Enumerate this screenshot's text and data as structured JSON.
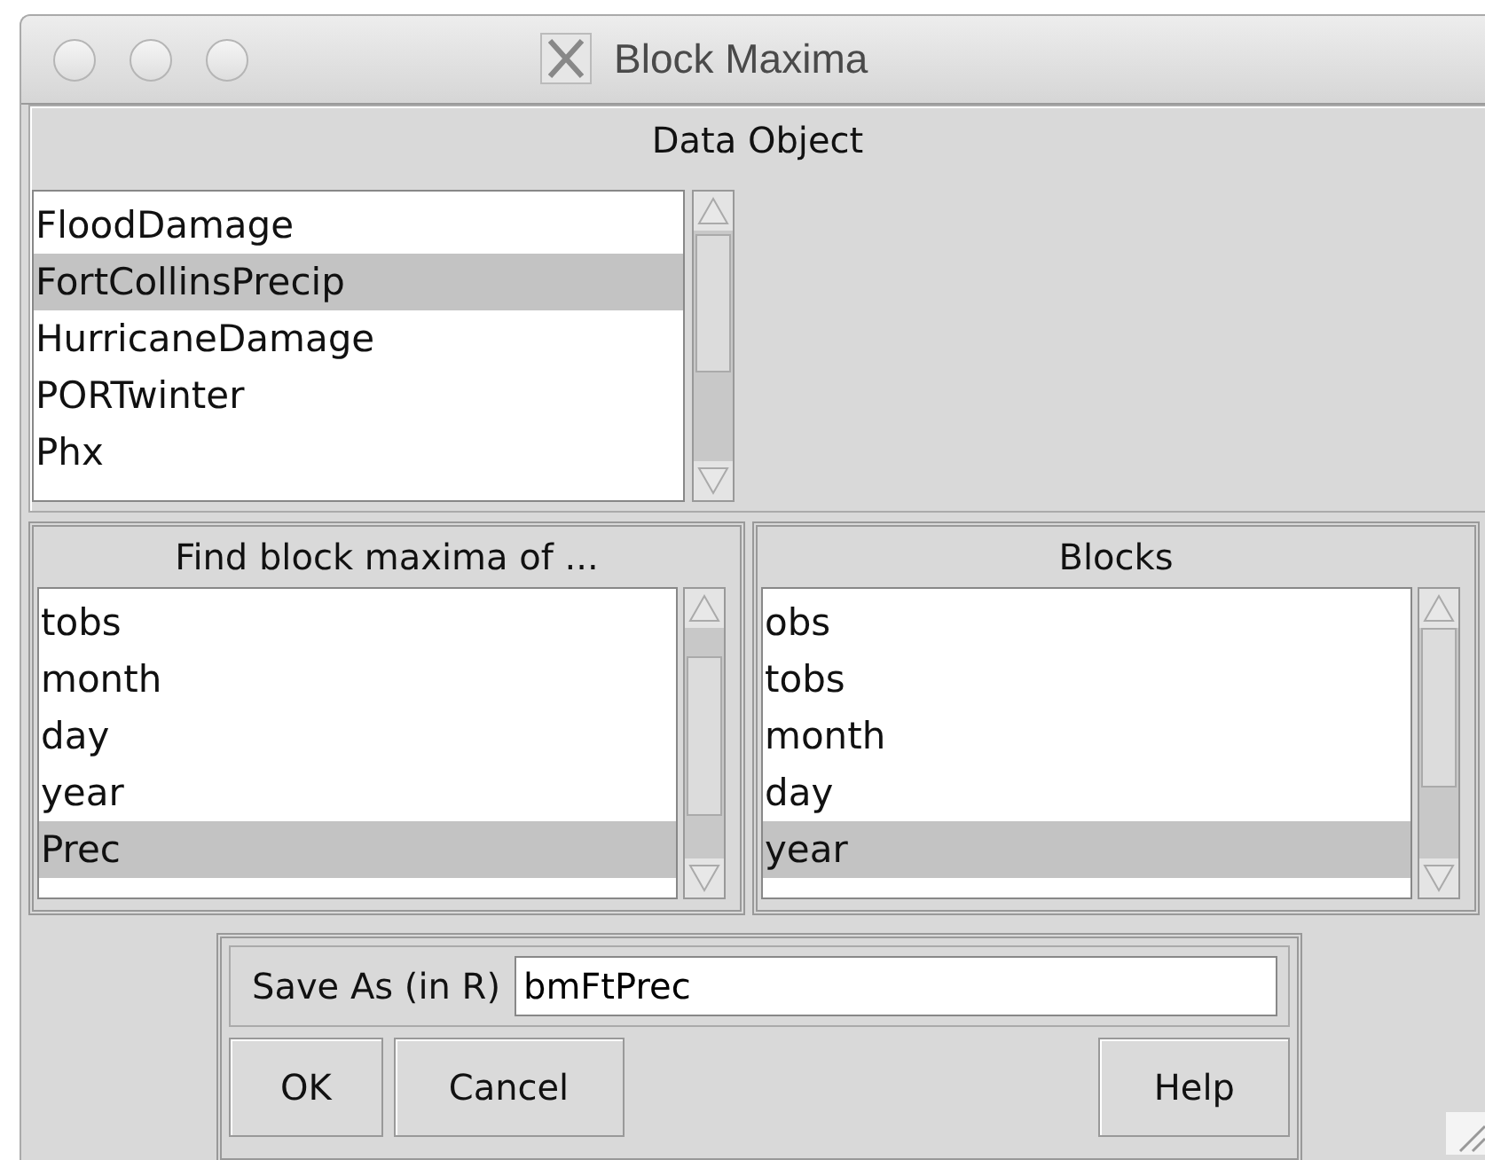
{
  "window": {
    "title": "Block Maxima"
  },
  "data_object": {
    "label": "Data Object",
    "items": [
      {
        "label": "FloodDamage",
        "selected": false
      },
      {
        "label": "FortCollinsPrecip",
        "selected": true
      },
      {
        "label": "HurricaneDamage",
        "selected": false
      },
      {
        "label": "PORTwinter",
        "selected": false
      },
      {
        "label": "Phx",
        "selected": false
      }
    ]
  },
  "panels": [
    {
      "label": "Find block maxima of ...",
      "items": [
        {
          "label": "tobs",
          "selected": false
        },
        {
          "label": "month",
          "selected": false
        },
        {
          "label": "day",
          "selected": false
        },
        {
          "label": "year",
          "selected": false
        },
        {
          "label": "Prec",
          "selected": true
        }
      ]
    },
    {
      "label": "Blocks",
      "items": [
        {
          "label": "obs",
          "selected": false
        },
        {
          "label": "tobs",
          "selected": false
        },
        {
          "label": "month",
          "selected": false
        },
        {
          "label": "day",
          "selected": false
        },
        {
          "label": "year",
          "selected": true
        }
      ]
    }
  ],
  "save_as": {
    "label": "Save As (in R)",
    "value": "bmFtPrec"
  },
  "buttons": [
    {
      "label": "OK",
      "kind": "left"
    },
    {
      "label": "Cancel",
      "kind": "left"
    },
    {
      "label": "Help",
      "kind": "right"
    }
  ]
}
